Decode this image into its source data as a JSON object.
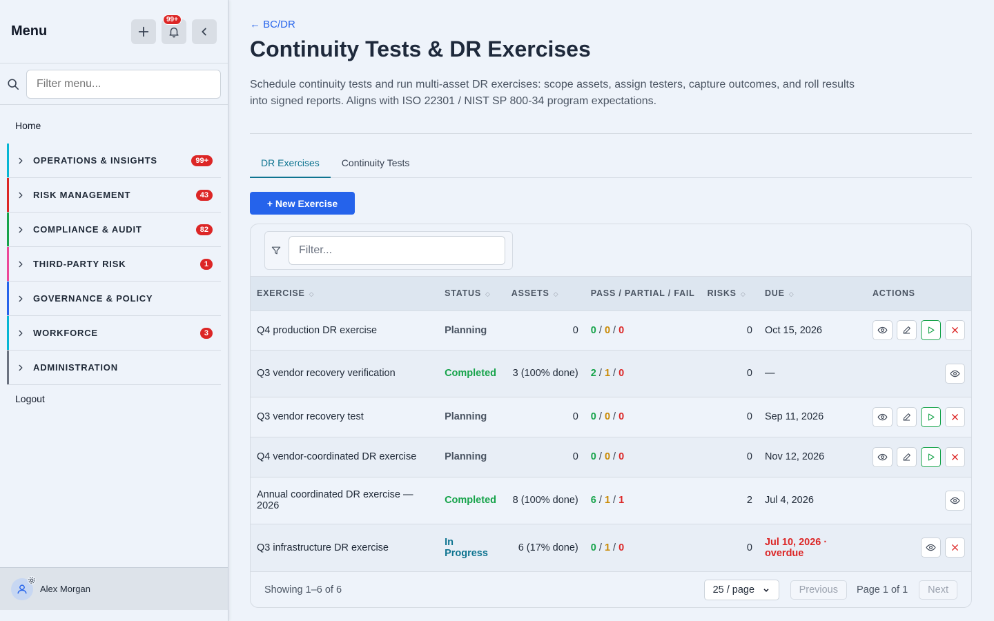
{
  "sidebar": {
    "title": "Menu",
    "notif_badge": "99+",
    "filter_placeholder": "Filter menu...",
    "home": "Home",
    "items": [
      {
        "label": "OPERATIONS & INSIGHTS",
        "badge": "99+",
        "color": "#06b6d4"
      },
      {
        "label": "RISK MANAGEMENT",
        "badge": "43",
        "color": "#dc2626"
      },
      {
        "label": "COMPLIANCE & AUDIT",
        "badge": "82",
        "color": "#16a34a"
      },
      {
        "label": "THIRD-PARTY RISK",
        "badge": "1",
        "color": "#ec4899"
      },
      {
        "label": "GOVERNANCE & POLICY",
        "badge": "",
        "color": "#2563eb"
      },
      {
        "label": "WORKFORCE",
        "badge": "3",
        "color": "#06b6d4"
      },
      {
        "label": "ADMINISTRATION",
        "badge": "",
        "color": "#6b7280"
      }
    ],
    "logout": "Logout",
    "user": "Alex Morgan"
  },
  "main": {
    "back": "← BC/DR",
    "title": "Continuity Tests & DR Exercises",
    "description": "Schedule continuity tests and run multi-asset DR exercises: scope assets, assign testers, capture outcomes, and roll results into signed reports. Aligns with ISO 22301 / NIST SP 800-34 program expectations.",
    "tabs": [
      {
        "label": "DR Exercises",
        "active": true
      },
      {
        "label": "Continuity Tests",
        "active": false
      }
    ],
    "new_button": "+ New Exercise",
    "filter_placeholder": "Filter...",
    "columns": [
      "EXERCISE",
      "STATUS",
      "ASSETS",
      "PASS / PARTIAL / FAIL",
      "RISKS",
      "DUE",
      "ACTIONS"
    ],
    "rows": [
      {
        "exercise": "Q4 production DR exercise",
        "status": "Planning",
        "assets": "0",
        "pass": "0",
        "partial": "0",
        "fail": "0",
        "risks": "0",
        "due": "Oct 15, 2026",
        "overdue": false,
        "actions": [
          "view",
          "edit",
          "run",
          "delete"
        ]
      },
      {
        "exercise": "Q3 vendor recovery verification",
        "status": "Completed",
        "assets": "3 (100% done)",
        "pass": "2",
        "partial": "1",
        "fail": "0",
        "risks": "0",
        "due": "—",
        "overdue": false,
        "actions": [
          "view"
        ]
      },
      {
        "exercise": "Q3 vendor recovery test",
        "status": "Planning",
        "assets": "0",
        "pass": "0",
        "partial": "0",
        "fail": "0",
        "risks": "0",
        "due": "Sep 11, 2026",
        "overdue": false,
        "actions": [
          "view",
          "edit",
          "run",
          "delete"
        ]
      },
      {
        "exercise": "Q4 vendor-coordinated DR exercise",
        "status": "Planning",
        "assets": "0",
        "pass": "0",
        "partial": "0",
        "fail": "0",
        "risks": "0",
        "due": "Nov 12, 2026",
        "overdue": false,
        "actions": [
          "view",
          "edit",
          "run",
          "delete"
        ]
      },
      {
        "exercise": "Annual coordinated DR exercise — 2026",
        "status": "Completed",
        "assets": "8 (100% done)",
        "pass": "6",
        "partial": "1",
        "fail": "1",
        "risks": "2",
        "due": "Jul 4, 2026",
        "overdue": false,
        "actions": [
          "view"
        ]
      },
      {
        "exercise": "Q3 infrastructure DR exercise",
        "status": "In Progress",
        "assets": "6 (17% done)",
        "pass": "0",
        "partial": "1",
        "fail": "0",
        "risks": "0",
        "due": "Jul 10, 2026 · overdue",
        "overdue": true,
        "actions": [
          "view",
          "delete"
        ]
      }
    ],
    "footer": {
      "showing": "Showing 1–6 of 6",
      "per_page": "25 / page",
      "previous": "Previous",
      "page_info": "Page 1 of 1",
      "next": "Next"
    }
  }
}
